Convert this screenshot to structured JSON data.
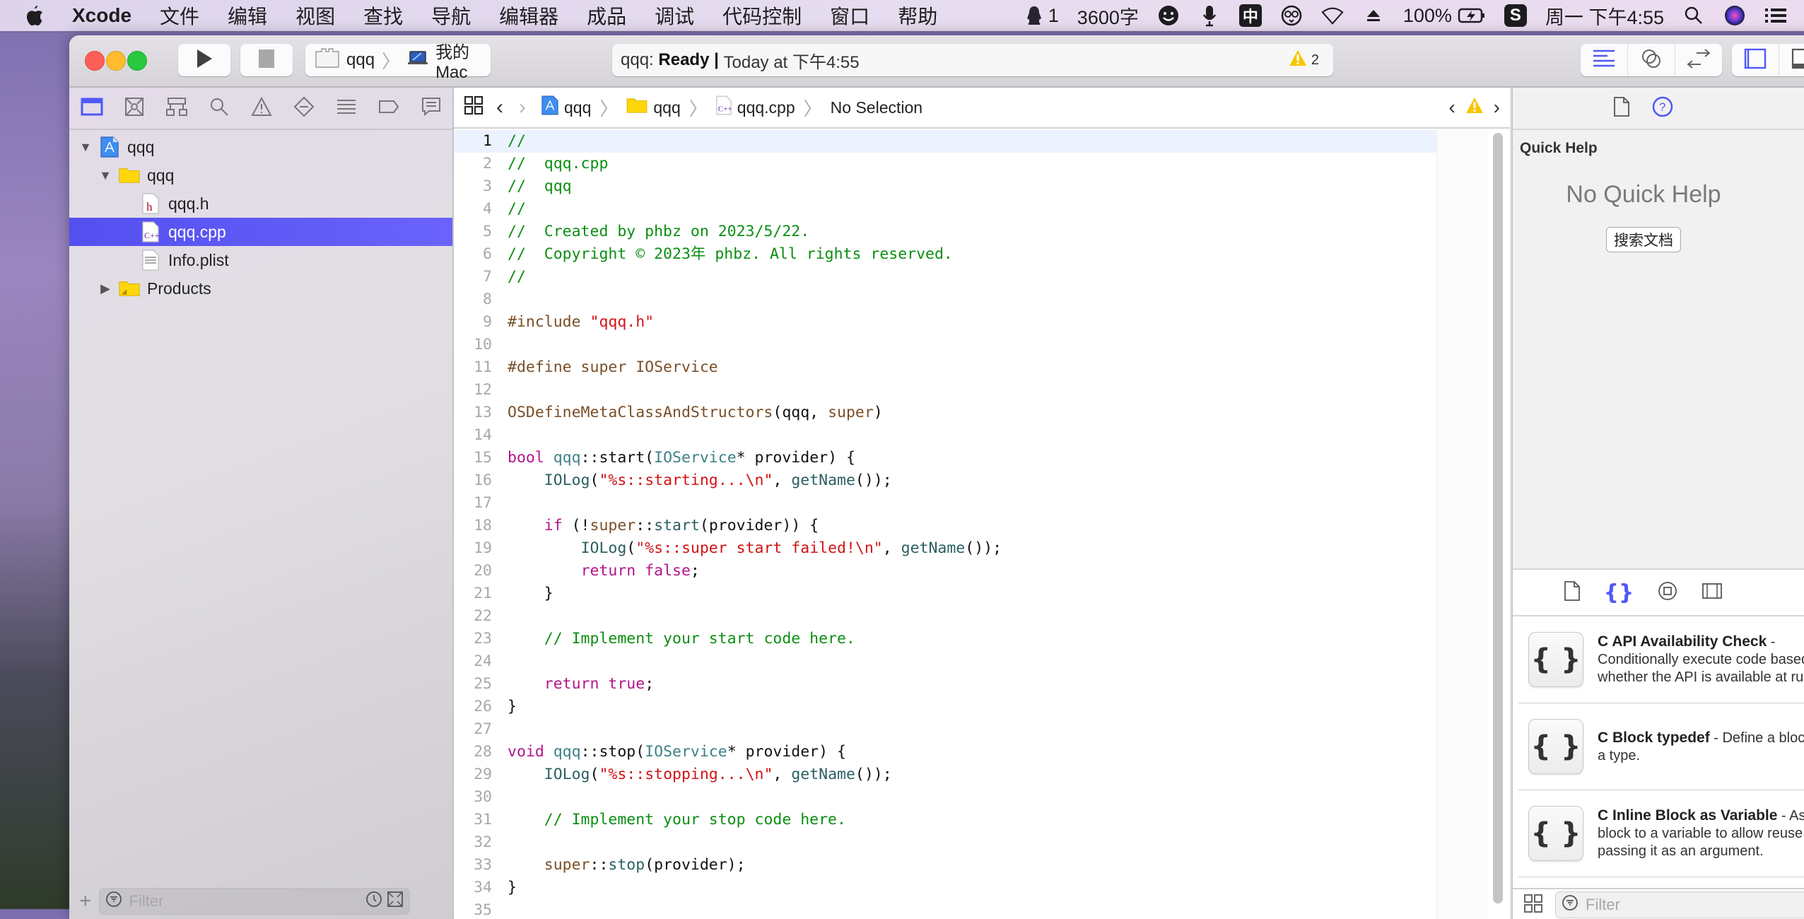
{
  "menubar": {
    "app_name": "Xcode",
    "menus": [
      "文件",
      "编辑",
      "视图",
      "查找",
      "导航",
      "编辑器",
      "成品",
      "调试",
      "代码控制",
      "窗口",
      "帮助"
    ],
    "status": {
      "qq_count": "1",
      "word_count": "3600字",
      "input_method": "中",
      "battery": "100%",
      "clock": "周一 下午4:55"
    }
  },
  "toolbar": {
    "scheme": "qqq",
    "destination": "我的 Mac",
    "activity_project": "qqq:",
    "activity_status": "Ready",
    "activity_sep": "|",
    "activity_time": "Today at 下午4:55",
    "warning_count": "2"
  },
  "navigator": {
    "tree": [
      {
        "label": "qqq",
        "kind": "project",
        "level": 0,
        "expanded": true
      },
      {
        "label": "qqq",
        "kind": "folder",
        "level": 1,
        "expanded": true
      },
      {
        "label": "qqq.h",
        "kind": "header",
        "level": 2
      },
      {
        "label": "qqq.cpp",
        "kind": "cpp",
        "level": 2,
        "selected": true
      },
      {
        "label": "Info.plist",
        "kind": "plist",
        "level": 2
      },
      {
        "label": "Products",
        "kind": "folder",
        "level": 1,
        "expanded": false
      }
    ],
    "filter_placeholder": "Filter"
  },
  "editor": {
    "breadcrumbs": [
      "qqq",
      "qqq",
      "qqq.cpp",
      "No Selection"
    ],
    "current_line": 1,
    "lines": [
      [
        [
          "com",
          "//"
        ]
      ],
      [
        [
          "com",
          "//  qqq.cpp"
        ]
      ],
      [
        [
          "com",
          "//  qqq"
        ]
      ],
      [
        [
          "com",
          "//"
        ]
      ],
      [
        [
          "com",
          "//  Created by phbz on 2023/5/22."
        ]
      ],
      [
        [
          "com",
          "//  Copyright © 2023年 phbz. All rights reserved."
        ]
      ],
      [
        [
          "com",
          "//"
        ]
      ],
      [],
      [
        [
          "pre",
          "#include "
        ],
        [
          "str",
          "\"qqq.h\""
        ]
      ],
      [],
      [
        [
          "pre",
          "#define super IOService"
        ]
      ],
      [],
      [
        [
          "mac",
          "OSDefineMetaClassAndStructors"
        ],
        [
          "pl",
          "(qqq, "
        ],
        [
          "mac",
          "super"
        ],
        [
          "pl",
          ")"
        ]
      ],
      [],
      [
        [
          "kw",
          "bool"
        ],
        [
          "pl",
          " "
        ],
        [
          "type",
          "qqq"
        ],
        [
          "pl",
          "::start("
        ],
        [
          "type",
          "IOService"
        ],
        [
          "pl",
          "* provider) {"
        ]
      ],
      [
        [
          "pl",
          "    "
        ],
        [
          "fn",
          "IOLog"
        ],
        [
          "pl",
          "("
        ],
        [
          "str",
          "\"%s::starting...\\n\""
        ],
        [
          "pl",
          ", "
        ],
        [
          "fn",
          "getName"
        ],
        [
          "pl",
          "());"
        ]
      ],
      [],
      [
        [
          "pl",
          "    "
        ],
        [
          "kw",
          "if"
        ],
        [
          "pl",
          " (!"
        ],
        [
          "mac",
          "super"
        ],
        [
          "pl",
          "::"
        ],
        [
          "fn",
          "start"
        ],
        [
          "pl",
          "(provider)) {"
        ]
      ],
      [
        [
          "pl",
          "        "
        ],
        [
          "fn",
          "IOLog"
        ],
        [
          "pl",
          "("
        ],
        [
          "str",
          "\"%s::super start failed!\\n\""
        ],
        [
          "pl",
          ", "
        ],
        [
          "fn",
          "getName"
        ],
        [
          "pl",
          "());"
        ]
      ],
      [
        [
          "pl",
          "        "
        ],
        [
          "kw",
          "return"
        ],
        [
          "pl",
          " "
        ],
        [
          "kw",
          "false"
        ],
        [
          "pl",
          ";"
        ]
      ],
      [
        [
          "pl",
          "    }"
        ]
      ],
      [],
      [
        [
          "pl",
          "    "
        ],
        [
          "com",
          "// Implement your start code here."
        ]
      ],
      [],
      [
        [
          "pl",
          "    "
        ],
        [
          "kw",
          "return"
        ],
        [
          "pl",
          " "
        ],
        [
          "kw",
          "true"
        ],
        [
          "pl",
          ";"
        ]
      ],
      [
        [
          "pl",
          "}"
        ]
      ],
      [],
      [
        [
          "kw",
          "void"
        ],
        [
          "pl",
          " "
        ],
        [
          "type",
          "qqq"
        ],
        [
          "pl",
          "::stop("
        ],
        [
          "type",
          "IOService"
        ],
        [
          "pl",
          "* provider) {"
        ]
      ],
      [
        [
          "pl",
          "    "
        ],
        [
          "fn",
          "IOLog"
        ],
        [
          "pl",
          "("
        ],
        [
          "str",
          "\"%s::stopping...\\n\""
        ],
        [
          "pl",
          ", "
        ],
        [
          "fn",
          "getName"
        ],
        [
          "pl",
          "());"
        ]
      ],
      [],
      [
        [
          "pl",
          "    "
        ],
        [
          "com",
          "// Implement your stop code here."
        ]
      ],
      [],
      [
        [
          "pl",
          "    "
        ],
        [
          "mac",
          "super"
        ],
        [
          "pl",
          "::"
        ],
        [
          "fn",
          "stop"
        ],
        [
          "pl",
          "(provider);"
        ]
      ],
      [
        [
          "pl",
          "}"
        ]
      ],
      []
    ]
  },
  "inspector": {
    "title": "Quick Help",
    "empty_message": "No Quick Help",
    "search_docs_button": "搜索文档",
    "library": [
      {
        "title": "C API Availability Check",
        "desc_inline": " -",
        "desc": [
          "Conditionally execute code based on",
          "whether the API is available at runtime."
        ]
      },
      {
        "title": "C Block typedef",
        "desc_inline": " - Define a block as",
        "desc": [
          "a type."
        ]
      },
      {
        "title": "C Inline Block as Variable",
        "desc_inline": " - Assign a",
        "desc": [
          "block to a variable to allow reuse or",
          "passing it as an argument."
        ]
      }
    ],
    "filter_placeholder": "Filter"
  },
  "colors": {
    "accent": "#4f59f7",
    "selection": "#5a52f3",
    "warning": "#f7c600",
    "comment": "#0b8e12",
    "string": "#d21414",
    "keyword": "#b3148c"
  }
}
